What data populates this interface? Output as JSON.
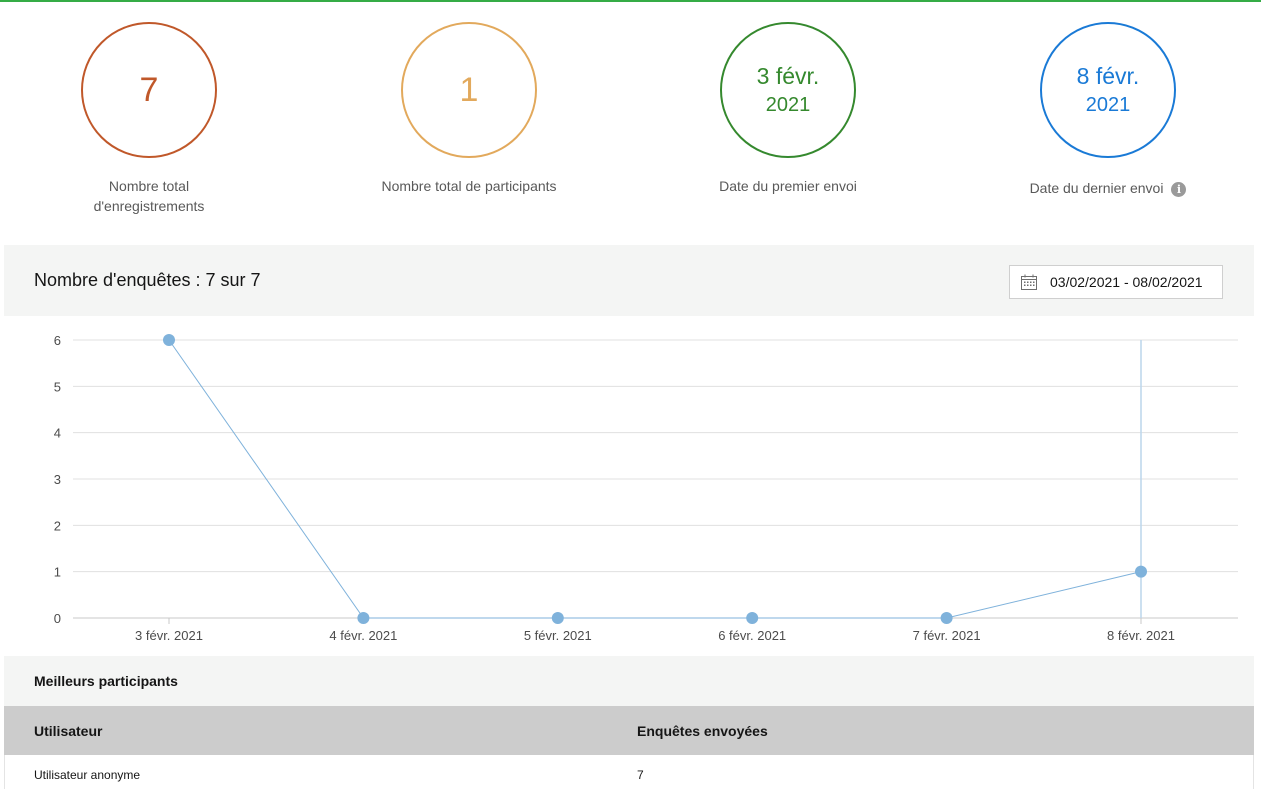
{
  "colors": {
    "records": "#c0582a",
    "participants": "#e2a95c",
    "first_date": "#35892e",
    "last_date": "#1a7ad6",
    "series": "#7fb2db",
    "accent_bar": "#35ac46"
  },
  "stats": [
    {
      "value": "7",
      "label_line1": "Nombre total",
      "label_line2": "d'enregistrements"
    },
    {
      "value": "1",
      "label_line1": "Nombre total de participants",
      "label_line2": ""
    },
    {
      "date_main": "3 févr.",
      "date_year": "2021",
      "label_line1": "Date du premier envoi",
      "label_line2": ""
    },
    {
      "date_main": "8 févr.",
      "date_year": "2021",
      "label_line1": "Date du dernier envoi",
      "label_line2": "",
      "info_icon": "info-icon"
    }
  ],
  "survey_panel": {
    "title": "Nombre d'enquêtes : 7 sur 7",
    "date_range": "03/02/2021 - 08/02/2021",
    "calendar_icon": "calendar-icon"
  },
  "chart_data": {
    "type": "line",
    "title": "",
    "xlabel": "",
    "ylabel": "",
    "categories": [
      "3 févr. 2021",
      "4 févr. 2021",
      "5 févr. 2021",
      "6 févr. 2021",
      "7 févr. 2021",
      "8 févr. 2021"
    ],
    "values": [
      6,
      0,
      0,
      0,
      0,
      1
    ],
    "yticks": [
      0,
      1,
      2,
      3,
      4,
      5,
      6
    ],
    "ylim": [
      0,
      6
    ],
    "grid": true
  },
  "top_participants": {
    "title": "Meilleurs participants",
    "columns": [
      "Utilisateur",
      "Enquêtes envoyées"
    ],
    "rows": [
      [
        "Utilisateur anonyme",
        "7"
      ]
    ]
  }
}
